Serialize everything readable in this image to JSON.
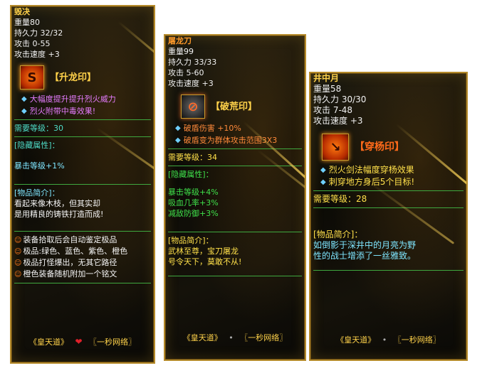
{
  "panels": [
    {
      "name": "毁决",
      "stats": [
        "重量80",
        "持久力 32/32",
        "攻击 0-55",
        "攻击速度 +3"
      ],
      "seal_icon": "dragon-seal-icon",
      "seal_label": "【升龙印】",
      "effects": [
        "大幅度提升提升烈火威力",
        "烈火附带中毒效果!"
      ],
      "required_level": "需要等级：30",
      "hidden_title": "[隐藏属性]：",
      "hidden_attrs": [
        "暴击等级+1%"
      ],
      "desc_title": "[物品简介]：",
      "desc_lines": [
        "看起来像木枝，但其实却",
        "是用精良的铸铁打造而成!"
      ],
      "promo_lines": [
        "装备拾取后会自动鉴定极品",
        "极品:绿色、蓝色、紫色、橙色",
        "极品打怪爆出，无其它路径",
        "橙色装备随机附加一个铭文"
      ],
      "footer_left": "《皇天道》",
      "footer_sep": "❤",
      "footer_right": "〖一秒网络〗"
    },
    {
      "name": "屠龙刀",
      "stats": [
        "重量99",
        "持久力 33/33",
        "攻击 5-60",
        "攻击速度 +3"
      ],
      "seal_icon": "shield-break-seal-icon",
      "seal_label": "【破荒印】",
      "effects": [
        "破盾伤害 +10%",
        "破盾变为群体攻击范围3X3"
      ],
      "required_level": "需要等级：34",
      "hidden_title": "[隐藏属性]：",
      "hidden_attrs": [
        "暴击等级+4%",
        "吸血几率+3%",
        "减敌防御+3%"
      ],
      "desc_title": "[物品简介]：",
      "desc_lines": [
        "武林至尊，宝刀屠龙",
        "号令天下，莫敢不从!"
      ],
      "footer_left": "《皇天道》",
      "footer_sep": "•",
      "footer_right": "〖一秒网络〗"
    },
    {
      "name": "井中月",
      "stats": [
        "重量58",
        "持久力 30/30",
        "攻击 7-48",
        "攻击速度 +3"
      ],
      "seal_icon": "pierce-seal-icon",
      "seal_label": "【穿杨印】",
      "effects": [
        "烈火剑法幅度穿杨效果",
        "刺穿地方身后5个目标!"
      ],
      "required_level": "需要等级：28",
      "desc_title": "[物品简介]：",
      "desc_lines": [
        "如倒影于深井中的月亮为野",
        "性的战士增添了一丝雅致。"
      ],
      "footer_left": "《皇天道》",
      "footer_sep": "•",
      "footer_right": "〖一秒网络〗"
    }
  ]
}
